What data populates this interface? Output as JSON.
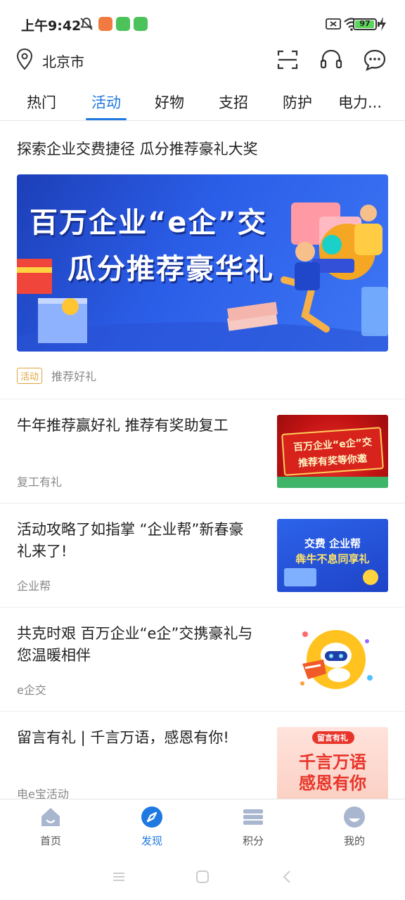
{
  "status_bar": {
    "time": "上午9:42",
    "battery": "97",
    "icons": [
      "mute-icon",
      "app-notification-icon",
      "app-notification-icon",
      "app-notification-icon",
      "no-sim-icon",
      "wifi-icon",
      "battery-icon",
      "charging-icon"
    ],
    "app_icon_colors": [
      "#f07a3f",
      "#4cc25b",
      "#4cc25b"
    ]
  },
  "header": {
    "location": "北京市",
    "icons": [
      "location-pin-icon",
      "scan-icon",
      "headset-icon",
      "message-icon"
    ]
  },
  "tabs": [
    {
      "label": "热门",
      "active": false
    },
    {
      "label": "活动",
      "active": true
    },
    {
      "label": "好物",
      "active": false
    },
    {
      "label": "支招",
      "active": false
    },
    {
      "label": "防护",
      "active": false
    },
    {
      "label": "电力...",
      "active": false
    }
  ],
  "featured": {
    "title": "探索企业交费捷径 瓜分推荐豪礼大奖",
    "banner_line1": "百万企业“e企”交",
    "banner_line2": "瓜分推荐豪华礼",
    "badge": "活动",
    "meta": "推荐好礼"
  },
  "items": [
    {
      "title": "牛年推荐赢好礼 推荐有奖助复工",
      "subtitle": "复工有礼",
      "thumb_line1": "百万企业“e企”交",
      "thumb_line2": "推荐有奖等你邀"
    },
    {
      "title": "活动攻略了如指掌 “企业帮”新春豪礼来了!",
      "subtitle": "企业帮",
      "thumb_line1": "交费 企业帮",
      "thumb_line2": "犇牛不息同享礼"
    },
    {
      "title": "共克时艰 百万企业“e企”交携豪礼与您温暖相伴",
      "subtitle": "e企交",
      "thumb_line1": "",
      "thumb_line2": ""
    },
    {
      "title": "留言有礼 | 千言万语，感恩有你!",
      "subtitle": "电e宝活动",
      "thumb_line1": "留言有礼",
      "thumb_line2": "千言万语",
      "thumb_line3": "感恩有你"
    }
  ],
  "bottom_nav": [
    {
      "label": "首页",
      "icon": "home-icon",
      "active": false
    },
    {
      "label": "发现",
      "icon": "compass-icon",
      "active": true
    },
    {
      "label": "积分",
      "icon": "points-icon",
      "active": false
    },
    {
      "label": "我的",
      "icon": "profile-icon",
      "active": false
    }
  ],
  "colors": {
    "accent": "#1f79e0",
    "badge": "#e0a33b",
    "text": "#222222",
    "muted": "#888888"
  }
}
